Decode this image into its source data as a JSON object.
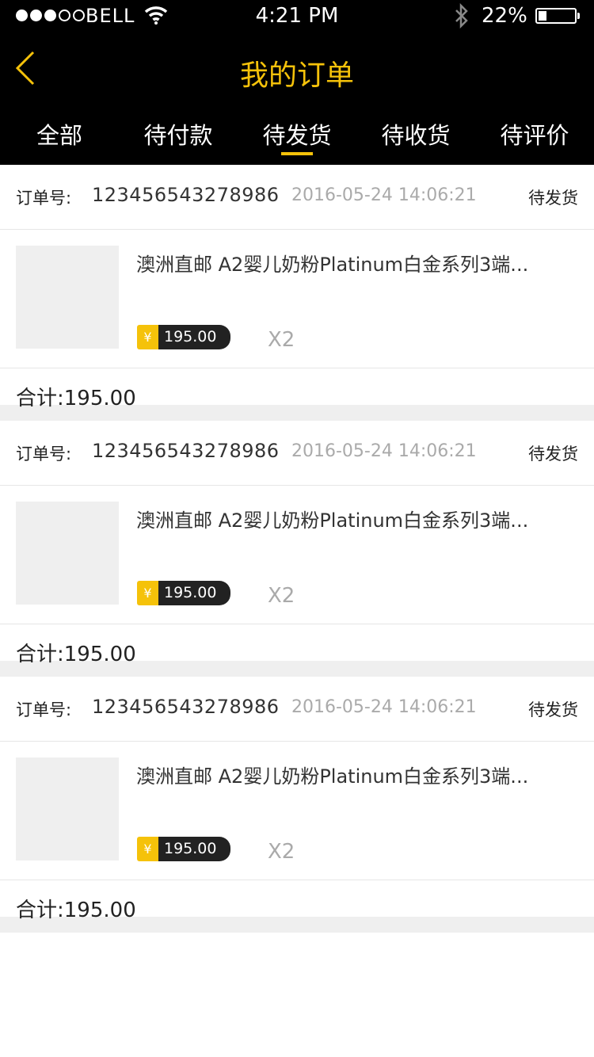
{
  "status_bar": {
    "carrier": "BELL",
    "time": "4:21 PM",
    "battery_percent": "22%",
    "battery_level": 0.22,
    "signal_bars_filled": 3,
    "signal_bars_total": 5
  },
  "nav": {
    "title": "我的订单",
    "back_icon": "chevron-left-icon",
    "accent_color": "#f5c20a"
  },
  "tabs": [
    {
      "label": "全部",
      "active": false
    },
    {
      "label": "待付款",
      "active": false
    },
    {
      "label": "待发货",
      "active": true
    },
    {
      "label": "待收货",
      "active": false
    },
    {
      "label": "待评价",
      "active": false
    }
  ],
  "orders": [
    {
      "order_label": "订单号:",
      "order_no": "123456543278986",
      "date": "2016-05-24 14:06:21",
      "status": "待发货",
      "product_name": "澳洲直邮 A2婴儿奶粉Platinum白金系列3端...",
      "currency": "¥",
      "price": "195.00",
      "quantity": "X2",
      "total_label": "合计:",
      "total": "195.00"
    },
    {
      "order_label": "订单号:",
      "order_no": "123456543278986",
      "date": "2016-05-24 14:06:21",
      "status": "待发货",
      "product_name": "澳洲直邮 A2婴儿奶粉Platinum白金系列3端...",
      "currency": "¥",
      "price": "195.00",
      "quantity": "X2",
      "total_label": "合计:",
      "total": "195.00"
    },
    {
      "order_label": "订单号:",
      "order_no": "123456543278986",
      "date": "2016-05-24 14:06:21",
      "status": "待发货",
      "product_name": "澳洲直邮 A2婴儿奶粉Platinum白金系列3端...",
      "currency": "¥",
      "price": "195.00",
      "quantity": "X2",
      "total_label": "合计:",
      "total": "195.00"
    }
  ]
}
